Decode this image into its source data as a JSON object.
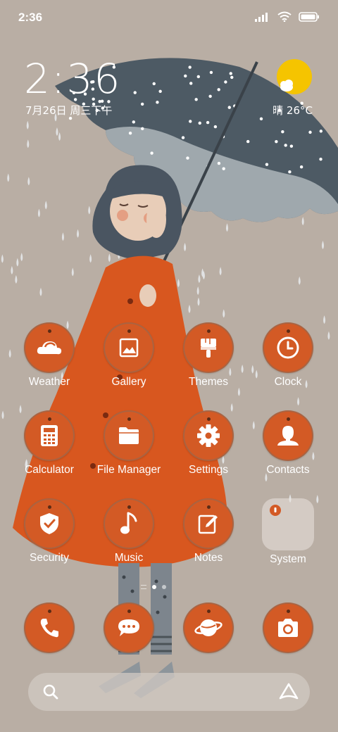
{
  "status_bar": {
    "time": "2:36",
    "signal_icon": "signal-icon",
    "wifi_icon": "wifi-icon",
    "battery_icon": "battery-icon"
  },
  "clock_widget": {
    "time": "2:36",
    "date": "7月26日 周三下午"
  },
  "weather_widget": {
    "text": "晴 26°C",
    "icon": "sun-cloud-icon"
  },
  "apps": [
    {
      "label": "Weather",
      "icon": "weather-icon"
    },
    {
      "label": "Gallery",
      "icon": "gallery-icon"
    },
    {
      "label": "Themes",
      "icon": "brush-icon"
    },
    {
      "label": "Clock",
      "icon": "clock-icon"
    },
    {
      "label": "Calculator",
      "icon": "calculator-icon"
    },
    {
      "label": "File Manager",
      "icon": "folder-icon"
    },
    {
      "label": "Settings",
      "icon": "gear-icon"
    },
    {
      "label": "Contacts",
      "icon": "person-icon"
    },
    {
      "label": "Security",
      "icon": "shield-icon"
    },
    {
      "label": "Music",
      "icon": "music-note-icon"
    },
    {
      "label": "Notes",
      "icon": "pencil-icon"
    },
    {
      "label": "System",
      "icon": "folder-icon"
    }
  ],
  "dock": [
    {
      "icon": "phone-icon"
    },
    {
      "icon": "message-icon"
    },
    {
      "icon": "browser-icon"
    },
    {
      "icon": "camera-icon"
    }
  ],
  "search_bar": {
    "search_icon": "search-icon",
    "assistant_icon": "assistant-icon"
  },
  "colors": {
    "icon_bg": "#d35a25",
    "wallpaper_bg": "#b9aea4",
    "umbrella": "#4d5a64",
    "coat": "#d8571f"
  }
}
